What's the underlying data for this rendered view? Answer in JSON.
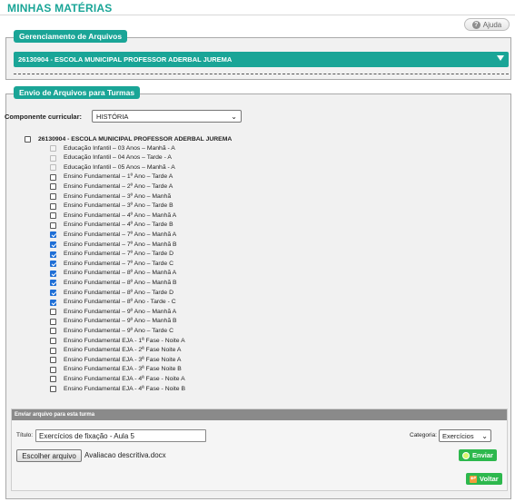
{
  "page": {
    "title": "MINHAS MATÉRIAS",
    "help_label": "Ajuda",
    "help_icon": "question-circle-icon"
  },
  "files_panel": {
    "legend": "Gerenciamento de Arquivos",
    "school": "26130904 - ESCOLA MUNICIPAL PROFESSOR ADERBAL JUREMA"
  },
  "send_panel": {
    "legend": "Envio de Arquivos para Turmas",
    "component_label": "Componente curricular:",
    "component_value": "HISTÓRIA",
    "school_checkbox_label": "26130904 - ESCOLA MUNICIPAL PROFESSOR ADERBAL JUREMA",
    "classes": [
      {
        "label": "Educação Infantil – 03 Anos – Manhã - A",
        "checked": false,
        "disabled": true
      },
      {
        "label": "Educação Infantil – 04 Anos – Tarde - A",
        "checked": false,
        "disabled": true
      },
      {
        "label": "Educação Infantil – 05 Anos – Manhã - A",
        "checked": false,
        "disabled": true
      },
      {
        "label": "Ensino Fundamental – 1º Ano – Tarde A",
        "checked": false,
        "disabled": false
      },
      {
        "label": "Ensino Fundamental – 2º Ano – Tarde A",
        "checked": false,
        "disabled": false
      },
      {
        "label": "Ensino Fundamental – 3º Ano – Manhã",
        "checked": false,
        "disabled": false
      },
      {
        "label": "Ensino Fundamental – 3º Ano – Tarde B",
        "checked": false,
        "disabled": false
      },
      {
        "label": "Ensino Fundamental – 4º Ano – Manhã A",
        "checked": false,
        "disabled": false
      },
      {
        "label": "Ensino Fundamental – 4º Ano – Tarde B",
        "checked": false,
        "disabled": false
      },
      {
        "label": "Ensino Fundamental – 7º Ano – Manhã A",
        "checked": true,
        "disabled": false
      },
      {
        "label": "Ensino Fundamental – 7º Ano – Manhã B",
        "checked": true,
        "disabled": false
      },
      {
        "label": "Ensino Fundamental – 7º Ano – Tarde D",
        "checked": true,
        "disabled": false
      },
      {
        "label": "Ensino Fundamental – 7º Ano – Tarde C",
        "checked": true,
        "disabled": false
      },
      {
        "label": "Ensino Fundamental – 8º Ano – Manhã A",
        "checked": true,
        "disabled": false
      },
      {
        "label": "Ensino Fundamental – 8º Ano – Manhã B",
        "checked": true,
        "disabled": false
      },
      {
        "label": "Ensino Fundamental – 8º Ano – Tarde D",
        "checked": true,
        "disabled": false
      },
      {
        "label": "Ensino Fundamental – 8º Ano - Tarde - C",
        "checked": true,
        "disabled": false
      },
      {
        "label": "Ensino Fundamental – 9º Ano – Manhã A",
        "checked": false,
        "disabled": false
      },
      {
        "label": "Ensino Fundamental – 9º Ano – Manhã B",
        "checked": false,
        "disabled": false
      },
      {
        "label": "Ensino Fundamental – 9º Ano – Tarde C",
        "checked": false,
        "disabled": false
      },
      {
        "label": "Ensino Fundamental EJA - 1ª Fase - Noite A",
        "checked": false,
        "disabled": false
      },
      {
        "label": "Ensino Fundamental EJA - 2ª Fase Noite A",
        "checked": false,
        "disabled": false
      },
      {
        "label": "Ensino Fundamental EJA - 3ª Fase Noite A",
        "checked": false,
        "disabled": false
      },
      {
        "label": "Ensino Fundamental EJA - 3ª Fase Noite B",
        "checked": false,
        "disabled": false
      },
      {
        "label": "Ensino Fundamental EJA - 4ª Fase - Noite A",
        "checked": false,
        "disabled": false
      },
      {
        "label": "Ensino Fundamental EJA - 4ª Fase - Noite B",
        "checked": false,
        "disabled": false
      }
    ]
  },
  "upload": {
    "header": "Enviar arquivo para esta turma",
    "title_label": "Título:",
    "title_value": "Exercícios de fixação - Aula 5",
    "category_label": "Categoria:",
    "category_value": "Exercícios",
    "file_button": "Escolher arquivo",
    "file_name": "Avaliacao descritiva.docx",
    "send_label": "Enviar",
    "back_label": "Voltar"
  },
  "colors": {
    "accent": "#1aa597",
    "checkbox_checked": "#1f6fd6",
    "button_green": "#2db84d"
  }
}
